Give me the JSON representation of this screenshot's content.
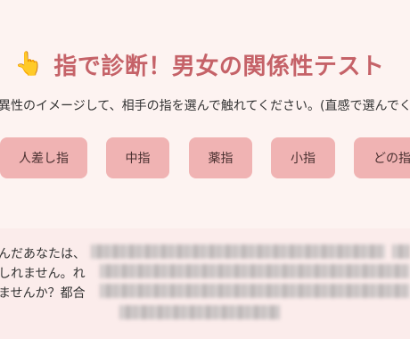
{
  "header": {
    "icon": "pointing-hand-icon",
    "icon_glyph": "👆",
    "title": "指で診断！男女の関係性テスト"
  },
  "instruction": "異性のイメージして、相手の指を選んで触れてください。(直感で選んでく",
  "fingers": [
    {
      "label": "人差し指"
    },
    {
      "label": "中指"
    },
    {
      "label": "薬指"
    },
    {
      "label": "小指"
    },
    {
      "label": "どの指"
    }
  ],
  "result": {
    "line1": "んだあなたは、",
    "line2": "しれません。れ",
    "line3": "ませんか？都合"
  },
  "colors": {
    "background": "#fdf3f1",
    "title": "#c56268",
    "button": "#f0b3b3",
    "result_background": "#fbeceb"
  }
}
